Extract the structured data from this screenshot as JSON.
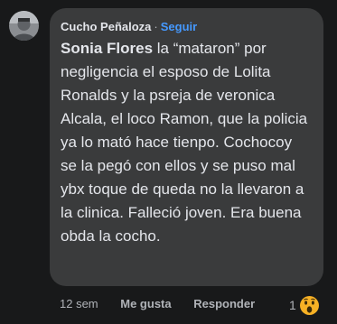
{
  "comment": {
    "author": "Cucho Peñaloza",
    "separator": "·",
    "follow_label": "Seguir",
    "mention": "Sonia Flores",
    "text": " la “mataron” por negligencia el esposo de Lolita Ronalds y la psreja de veronica Alcala, el loco Ramon, que la policia ya lo mató hace tienpo. Cochocoy se la pegó con ellos y se puso mal ybx toque de queda no la llevaron a la clinica. Falleció joven. Era buena obda la cocho.",
    "timestamp": "12 sem",
    "like_label": "Me gusta",
    "reply_label": "Responder",
    "reaction_count": "1",
    "reaction_icon": "wow-reaction-icon"
  },
  "colors": {
    "background": "#18191a",
    "bubble": "#3a3b3c",
    "text": "#e4e6eb",
    "secondary_text": "#b0b3b8",
    "link": "#4599ff"
  }
}
